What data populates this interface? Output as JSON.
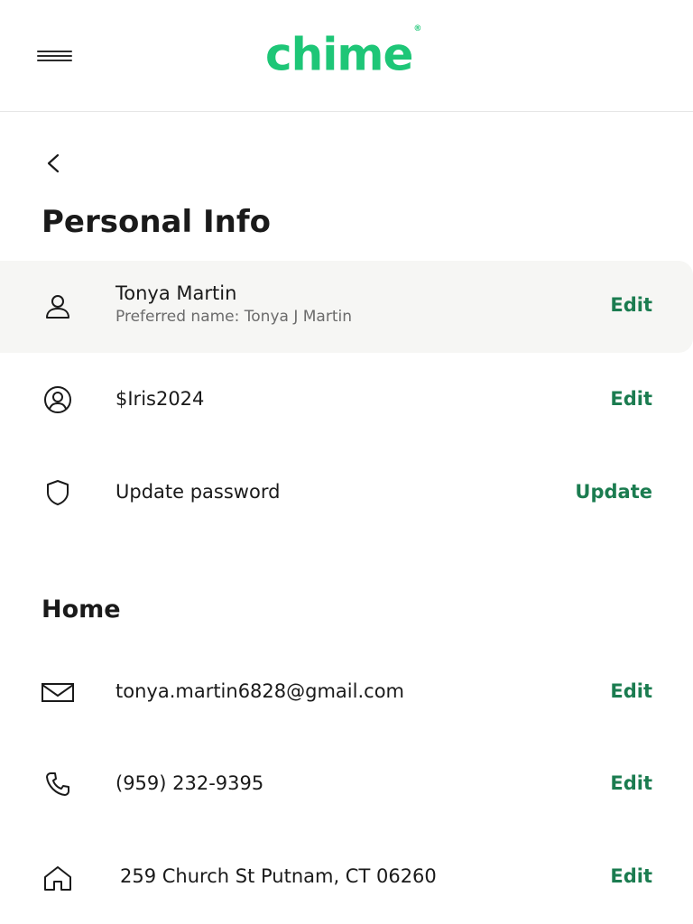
{
  "header": {
    "logo_text": "chime",
    "logo_mark": "®",
    "menu_icon": "hamburger-icon"
  },
  "nav": {
    "back_icon": "chevron-left-icon"
  },
  "page": {
    "title": "Personal Info"
  },
  "personal": {
    "name_row": {
      "icon": "user-icon",
      "primary": "Tonya Martin",
      "secondary": "Preferred name: Tonya J Martin",
      "action": "Edit"
    },
    "chimesign_row": {
      "icon": "user-circle-icon",
      "primary": "$Iris2024",
      "action": "Edit"
    },
    "password_row": {
      "icon": "shield-icon",
      "primary": "Update password",
      "action": "Update"
    }
  },
  "home": {
    "title": "Home",
    "email_row": {
      "icon": "mail-icon",
      "primary": "tonya.martin6828@gmail.com",
      "action": "Edit"
    },
    "phone_row": {
      "icon": "phone-icon",
      "primary": "(959) 232-9395",
      "action": "Edit"
    },
    "address_row": {
      "icon": "home-icon",
      "primary": "259 Church St Putnam, CT 06260",
      "action": "Edit"
    }
  },
  "colors": {
    "brand": "#1ec677",
    "action": "#1b7c50",
    "highlight_bg": "#f6f6f4"
  }
}
